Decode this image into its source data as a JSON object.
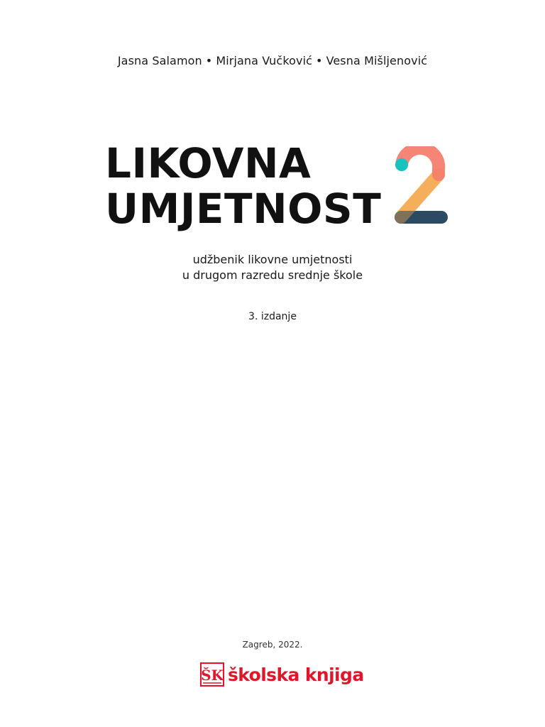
{
  "authors": [
    "Jasna Salamon",
    "Mirjana Vučković",
    "Vesna Mišljenović"
  ],
  "authors_separator": "•",
  "title": {
    "line1": "LIKOVNA",
    "line2": "UMJETNOST",
    "number": "2"
  },
  "subtitle": {
    "line1": "udžbenik likovne umjetnosti",
    "line2": "u drugom razredu srednje škole"
  },
  "edition": "3. izdanje",
  "place_year": "Zagreb, 2022.",
  "publisher": {
    "name": "školska knjiga",
    "mark_text": "ŠK",
    "color": "#e1162b"
  },
  "colors": {
    "two_coral": "#f4806e",
    "two_orange": "#f5a94e",
    "two_navy": "#2d4a63",
    "two_teal": "#15c3c0"
  }
}
